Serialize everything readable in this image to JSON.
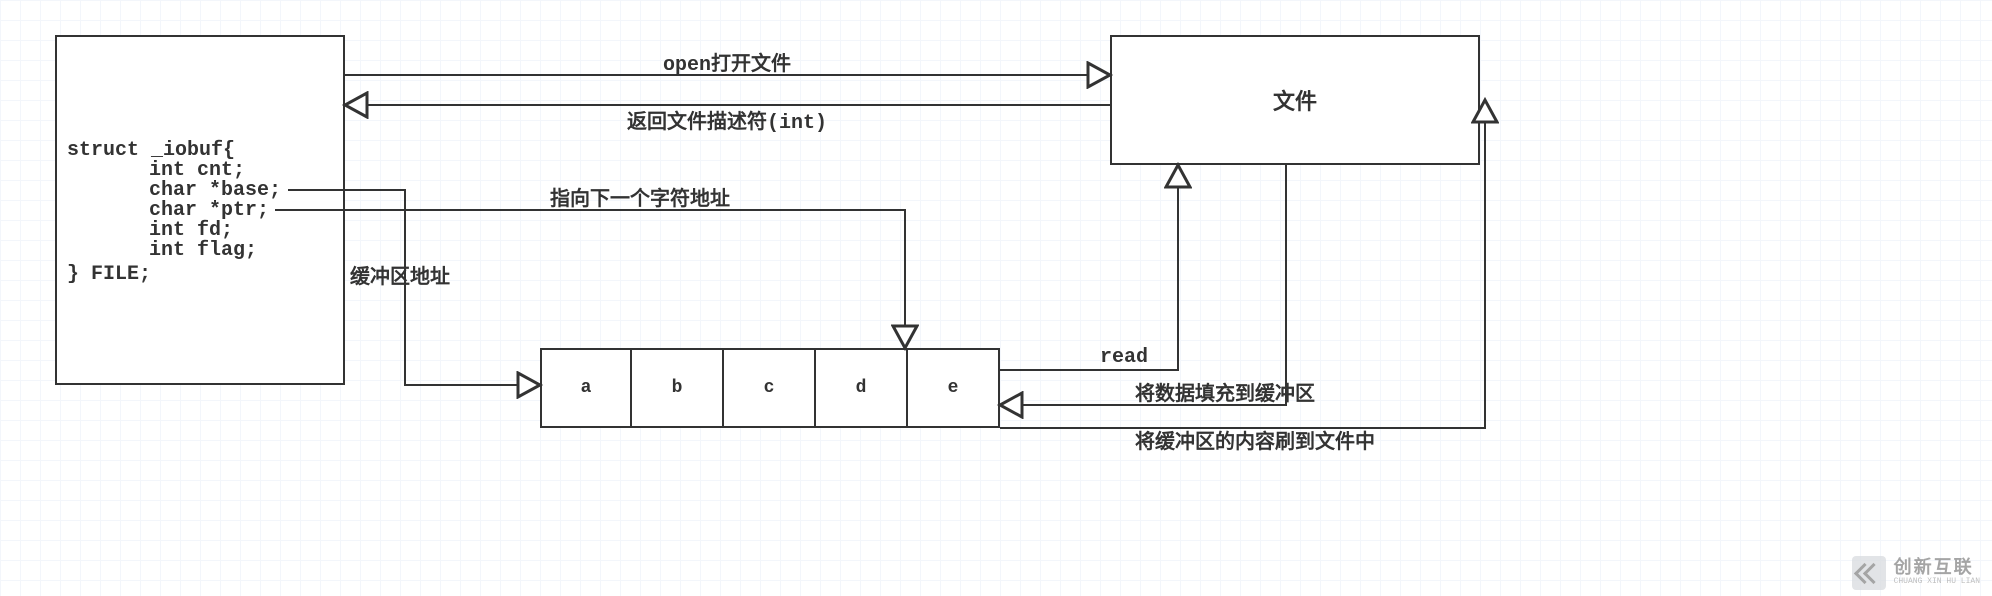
{
  "struct": {
    "header": "struct _iobuf{",
    "fields": [
      "int cnt;",
      "char *base;",
      "char *ptr;",
      "int fd;",
      "int flag;"
    ],
    "footer": "} FILE;"
  },
  "file_box": {
    "label": "文件"
  },
  "buffer": {
    "cells": [
      "a",
      "b",
      "c",
      "d",
      "e"
    ]
  },
  "labels": {
    "open": "open打开文件",
    "return_fd": "返回文件描述符(int)",
    "ptr_next": "指向下一个字符地址",
    "buf_addr": "缓冲区地址",
    "read": "read",
    "fill_buf": "将数据填充到缓冲区",
    "flush_to_file": "将缓冲区的内容刷到文件中"
  },
  "watermark": {
    "main": "创新互联",
    "sub": "CHUANG XIN HU LIAN"
  }
}
